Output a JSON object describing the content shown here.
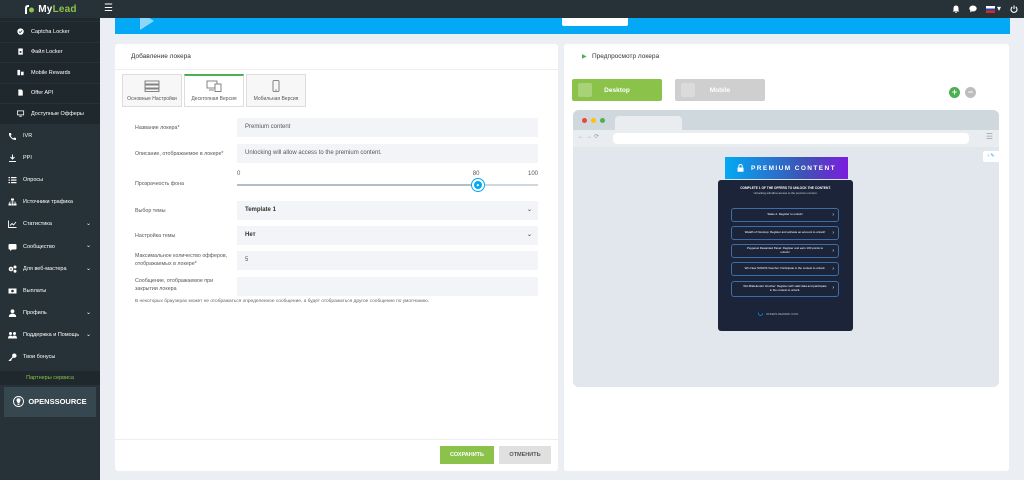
{
  "brand": {
    "name_prefix": "My",
    "name_suffix": "Lead"
  },
  "topbar": {
    "icons": [
      "bell-icon",
      "chat-icon",
      "flag-ru-icon",
      "power-icon"
    ]
  },
  "sidebar": {
    "sub_items": [
      {
        "label": "Captcha Locker",
        "icon": "check-circle-icon"
      },
      {
        "label": "Файл Locker",
        "icon": "file-lock-icon"
      },
      {
        "label": "Mobile Rewards",
        "icon": "mobile-rewards-icon"
      },
      {
        "label": "Offer API",
        "icon": "document-icon"
      },
      {
        "label": "Доступные Офферы",
        "icon": "monitor-icon"
      }
    ],
    "main_items": [
      {
        "label": "IVR",
        "icon": "phone-icon",
        "has_chevron": false
      },
      {
        "label": "PPI",
        "icon": "download-icon",
        "has_chevron": false
      },
      {
        "label": "Опросы",
        "icon": "list-icon",
        "has_chevron": false
      },
      {
        "label": "Источники трафика",
        "icon": "sitemap-icon",
        "has_chevron": false
      },
      {
        "label": "Статистика",
        "icon": "chart-icon",
        "has_chevron": true
      },
      {
        "label": "Сообщество",
        "icon": "community-icon",
        "has_chevron": true
      },
      {
        "label": "Для веб-мастера",
        "icon": "gears-icon",
        "has_chevron": true
      },
      {
        "label": "Выплаты",
        "icon": "money-icon",
        "has_chevron": false
      },
      {
        "label": "Профиль",
        "icon": "user-icon",
        "has_chevron": true
      },
      {
        "label": "Поддержка и Помощь",
        "icon": "support-icon",
        "has_chevron": true
      },
      {
        "label": "Твои бонусы",
        "icon": "key-icon",
        "has_chevron": false
      }
    ],
    "partners_label": "Партнеры сервиса",
    "partner_logo": "OPENSSOURCE"
  },
  "left_panel": {
    "title": "Добавление локера",
    "tabs": [
      {
        "label": "Основные Настройки",
        "icon": "server-icon",
        "active": false
      },
      {
        "label": "Десктопная Версия",
        "icon": "desktop-devices-icon",
        "active": true
      },
      {
        "label": "Мобильная Версия",
        "icon": "mobile-icon",
        "active": false
      }
    ],
    "fields": {
      "locker_name": {
        "label": "Название локера*",
        "value": "Premium content"
      },
      "locker_description": {
        "label": "Описание, отображаемое в локере*",
        "value": "Unlocking will allow access to the premium content."
      },
      "opacity": {
        "label": "Прозрачность фона",
        "min": 0,
        "max": 100,
        "value": 80,
        "min_label": "0",
        "max_label": "100",
        "value_label": "80"
      },
      "theme": {
        "label": "Выбор темы",
        "value": "Template 1"
      },
      "theme_settings": {
        "label": "Настройка темы",
        "value": "Нет"
      },
      "max_offers": {
        "label": "Максимальное количество офферов, отображаемых в локере*",
        "value": "5"
      },
      "close_message": {
        "label": "Сообщение, отображаемое при закрытии локера",
        "value": ""
      }
    },
    "note": "В некоторых браузерах может не отображаться определенное сообщение, а будет отображаться другое сообщение по умолчанию.",
    "buttons": {
      "save": "СОХРАНИТЬ",
      "cancel": "ОТМЕНИТЬ"
    }
  },
  "right_panel": {
    "title": "Предпросмотр локера",
    "device_buttons": {
      "desktop": "Desktop",
      "mobile": "Mobile"
    },
    "locker": {
      "header": "PREMIUM CONTENT",
      "intro": "COMPLETE 1 OF THE OFFERS TO UNLOCK THE CONTENT.",
      "intro_sub": "Unlocking will allow access to the premium content.",
      "offers": [
        "Stake 2. Register to unlock!",
        "Wealth of Nonstop: Register and activate an account to unlock!",
        "Paypanel Rewarded Panel: Register and earn 100 points to unlock!",
        "Win New SONOS Voucher: Participate in the contest to unlock.",
        "Win Bitdefender Voucher: Register with valid data and participate in the contest to unlock."
      ],
      "waiting": "OFFERS REWARD ICON"
    }
  },
  "colors": {
    "accent_green": "#8bc34a",
    "accent_blue": "#03a9f4",
    "sidebar_bg": "#263238"
  }
}
